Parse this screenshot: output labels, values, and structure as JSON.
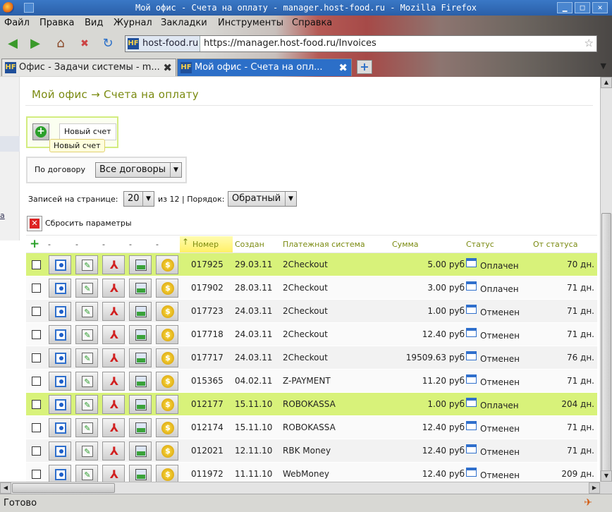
{
  "window": {
    "title": "Мой офис - Счета на оплату - manager.host-food.ru - Mozilla Firefox",
    "buttons": {
      "minimize": "▁",
      "maximize": "□",
      "close": "✕"
    }
  },
  "menu": [
    "Файл",
    "Правка",
    "Вид",
    "Журнал",
    "Закладки",
    "Инструменты",
    "Справка"
  ],
  "nav": {
    "back": "◀",
    "forward": "▶",
    "home": "⌂",
    "stop": "✖",
    "reload": "↻"
  },
  "address": {
    "site": "host-food.ru",
    "url": "https://manager.host-food.ru/Invoices",
    "favicon": "HF",
    "star": "☆"
  },
  "tabs": [
    {
      "label": "Офис - Задачи системы - m...",
      "close": "✖"
    },
    {
      "label": "Мой офис - Счета на опл...",
      "close": "✖"
    }
  ],
  "tab_extras": {
    "new_tab": "+",
    "list": "▼"
  },
  "sidebar": {
    "link": "а"
  },
  "page": {
    "breadcrumb": "Мой офис → Счета на оплату",
    "new_invoice": "Новый счет",
    "tooltip": "Новый счет",
    "filter_label": "По договору",
    "filter_value": "Все договоры",
    "perpage_label": "Записей на странице:",
    "perpage_value": "20",
    "perpage_of": "из 12 | Порядок:",
    "order_value": "Обратный",
    "reset_label": "Сбросить параметры"
  },
  "table": {
    "add_icon": "+",
    "dash": "-",
    "sort_arrow": "↑",
    "headers": {
      "number": "Номер",
      "created": "Создан",
      "system": "Платежная система",
      "sum": "Сумма",
      "status": "Статус",
      "from_status": "От статуса"
    },
    "icons": {
      "info": "",
      "edit": "✎",
      "pdf": "⅄",
      "mail": "",
      "pay": "$"
    },
    "rows": [
      {
        "number": "017925",
        "created": "29.03.11",
        "system": "2Checkout",
        "sum": "5.00 руб",
        "status": "Оплачен",
        "days": "70 дн.",
        "highlight": true
      },
      {
        "number": "017902",
        "created": "28.03.11",
        "system": "2Checkout",
        "sum": "3.00 руб",
        "status": "Оплачен",
        "days": "71 дн.",
        "highlight": false
      },
      {
        "number": "017723",
        "created": "24.03.11",
        "system": "2Checkout",
        "sum": "1.00 руб",
        "status": "Отменен",
        "days": "71 дн.",
        "highlight": false
      },
      {
        "number": "017718",
        "created": "24.03.11",
        "system": "2Checkout",
        "sum": "12.40 руб",
        "status": "Отменен",
        "days": "71 дн.",
        "highlight": false
      },
      {
        "number": "017717",
        "created": "24.03.11",
        "system": "2Checkout",
        "sum": "19509.63 руб",
        "status": "Отменен",
        "days": "76 дн.",
        "highlight": false
      },
      {
        "number": "015365",
        "created": "04.02.11",
        "system": "Z-PAYMENT",
        "sum": "11.20 руб",
        "status": "Отменен",
        "days": "71 дн.",
        "highlight": false
      },
      {
        "number": "012177",
        "created": "15.11.10",
        "system": "ROBOKASSA",
        "sum": "1.00 руб",
        "status": "Оплачен",
        "days": "204 дн.",
        "highlight": true
      },
      {
        "number": "012174",
        "created": "15.11.10",
        "system": "ROBOKASSA",
        "sum": "12.40 руб",
        "status": "Отменен",
        "days": "71 дн.",
        "highlight": false
      },
      {
        "number": "012021",
        "created": "12.11.10",
        "system": "RBK Money",
        "sum": "12.40 руб",
        "status": "Отменен",
        "days": "71 дн.",
        "highlight": false
      },
      {
        "number": "011972",
        "created": "11.11.10",
        "system": "WebMoney",
        "sum": "12.40 руб",
        "status": "Отменен",
        "days": "209 дн.",
        "highlight": false
      }
    ]
  },
  "scroll": {
    "up": "▲",
    "down": "▼",
    "left": "◀",
    "right": "▶"
  },
  "statusbar": {
    "text": "Готово",
    "icon": "✈"
  },
  "colors": {
    "accent": "#7a8a10",
    "highlight_row": "#d8f27a",
    "title_bar": "#2a5fa8"
  }
}
